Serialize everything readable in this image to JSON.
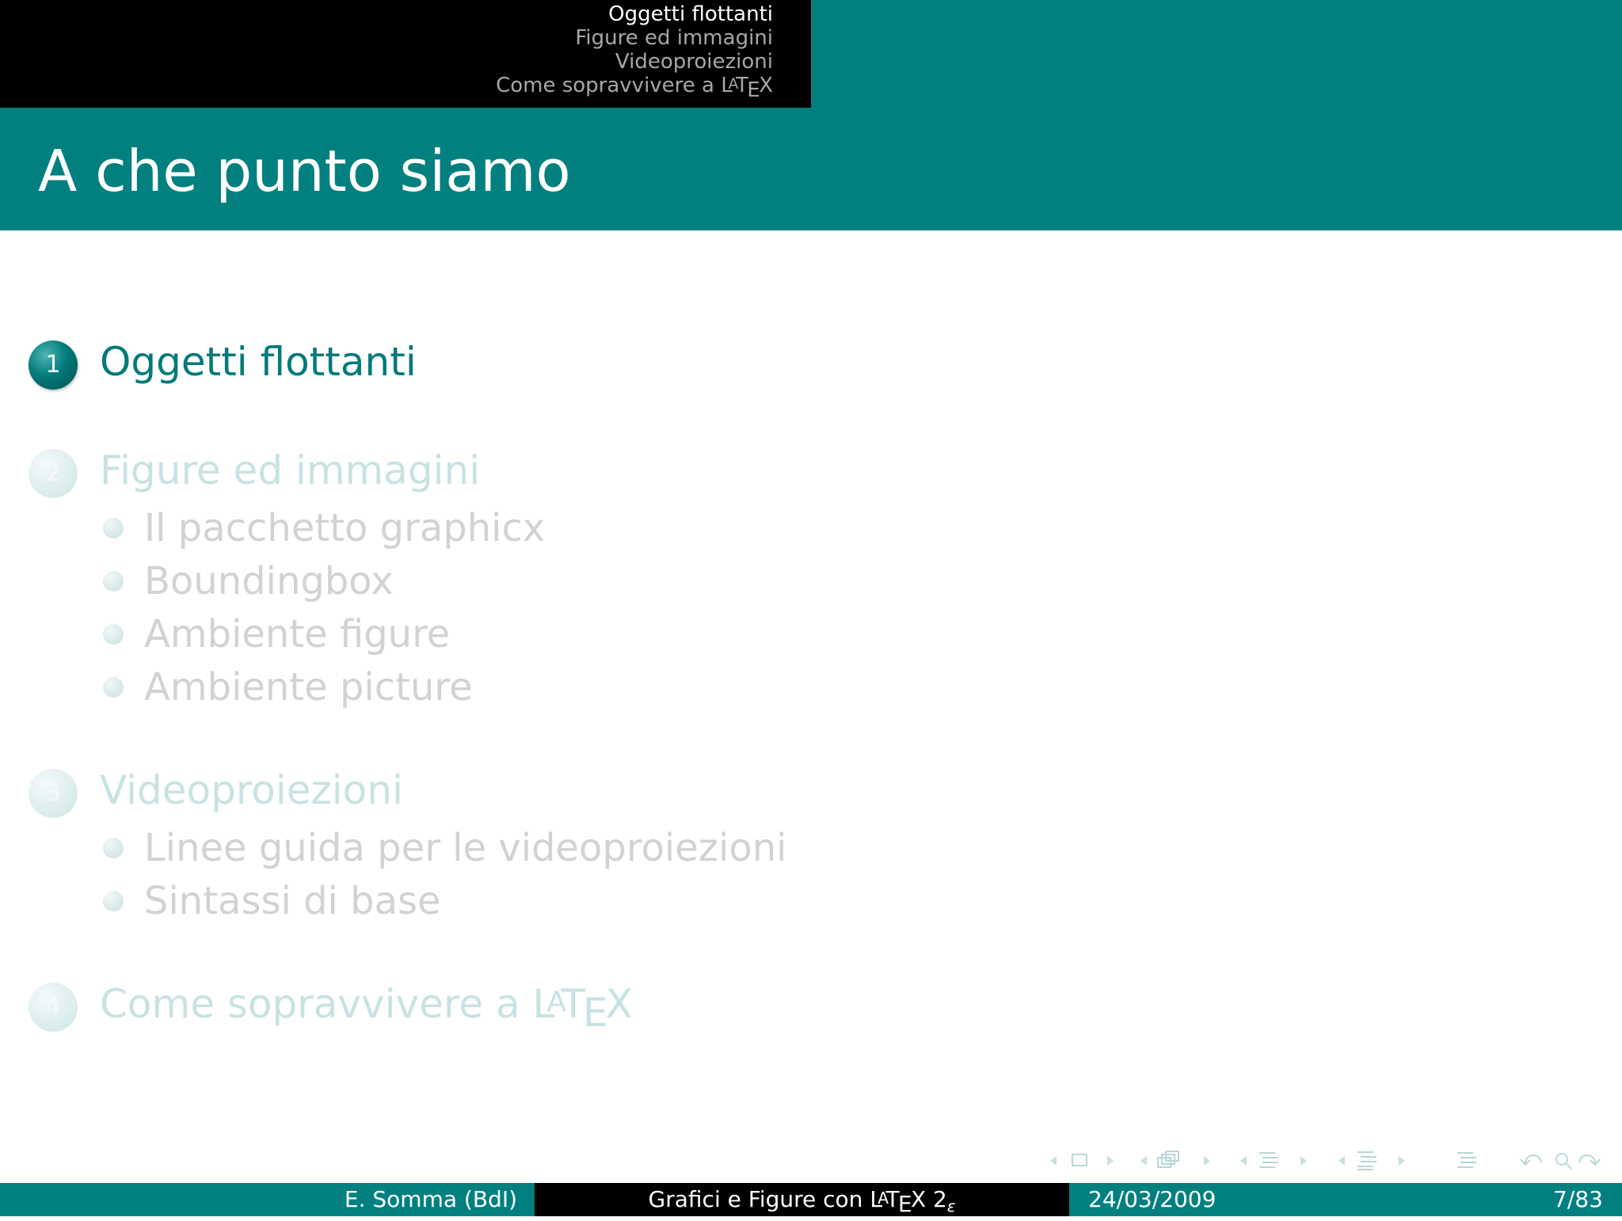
{
  "header": {
    "sections": [
      "Oggetti flottanti",
      "Figure ed immagini",
      "Videoproiezioni",
      "Come sopravvivere a"
    ],
    "latex_logo": "LaTeX"
  },
  "slide": {
    "title": "A che punto siamo"
  },
  "toc": {
    "sections": [
      {
        "number": "1",
        "label": "Oggetti flottanti"
      },
      {
        "number": "2",
        "label": "Figure ed immagini",
        "subsections": [
          "Il pacchetto graphicx",
          "Boundingbox",
          "Ambiente figure",
          "Ambiente picture"
        ]
      },
      {
        "number": "3",
        "label": "Videoproiezioni",
        "subsections": [
          "Linee guida per le videoproiezioni",
          "Sintassi di base"
        ]
      },
      {
        "number": "4",
        "label": "Come sopravvivere a"
      }
    ]
  },
  "footer": {
    "author": "E. Somma (BdI)",
    "title": "Grafici e Figure con",
    "title_suffix": "2",
    "title_epsilon": "ε",
    "date": "24/03/2009",
    "page": "7/83"
  },
  "controls": {
    "icons": [
      "nav-frame-prev",
      "nav-frame",
      "nav-frame-next",
      "nav-subsection-prev",
      "nav-subsection",
      "nav-subsection-next",
      "nav-section-prev",
      "nav-section",
      "nav-section-next",
      "nav-document-prev",
      "nav-document",
      "nav-document-next",
      "nav-appendix",
      "nav-back",
      "nav-search",
      "nav-forward"
    ]
  },
  "colors": {
    "accent": "#028080",
    "active_text": "#047a7a",
    "dim_text": "#c8e2e2",
    "dim_sub": "#d2d2d2"
  }
}
